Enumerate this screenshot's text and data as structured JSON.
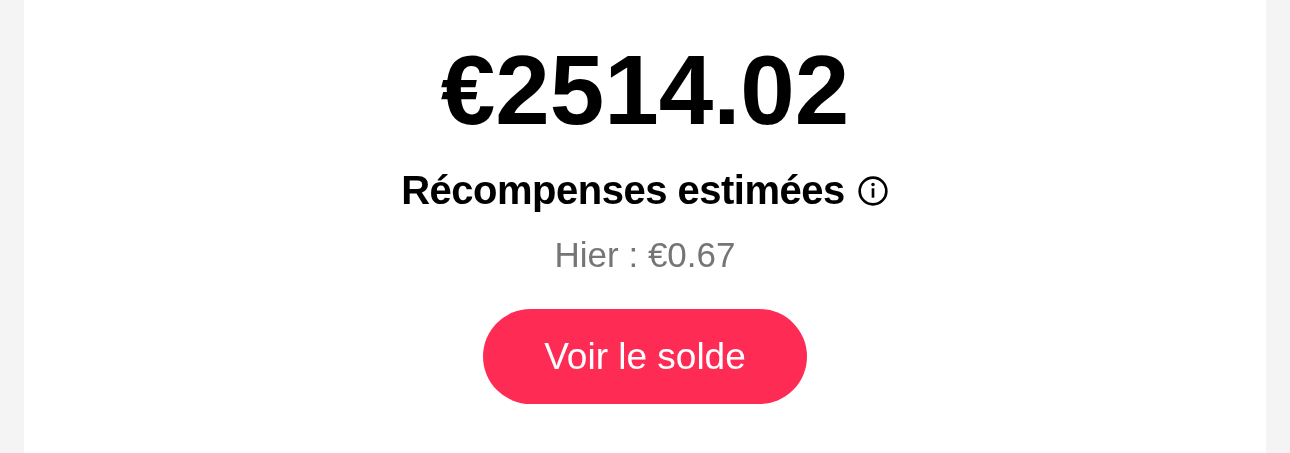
{
  "balance": {
    "amount": "€2514.02",
    "label": "Récompenses estimées",
    "yesterday": "Hier : €0.67"
  },
  "button": {
    "label": "Voir le solde"
  }
}
